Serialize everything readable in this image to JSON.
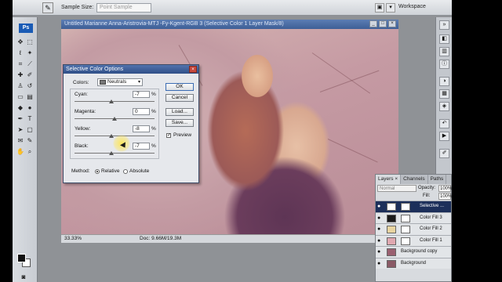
{
  "options_bar": {
    "tool_icon": "eyedropper-icon",
    "sample_size_label": "Sample Size:",
    "sample_size_value": "Point Sample",
    "workspace_label": "Workspace"
  },
  "tools_panel": {
    "logo": "Ps"
  },
  "document": {
    "title": "Untitled Marianne Anna-Aristrovia-MTJ -Fy-Kgent-RGB 3 (Selective Color 1 Layer Mask/8)",
    "zoom": "33.33%",
    "doc_info": "Doc: 9.66M/19.3M"
  },
  "dialog": {
    "title": "Selective Color Options",
    "colors_label": "Colors:",
    "colors_value": "Neutrals",
    "sliders": [
      {
        "label": "Cyan:",
        "value": "-7",
        "unit": "%",
        "level": 0.465
      },
      {
        "label": "Magenta:",
        "value": "0",
        "unit": "%",
        "level": 0.5
      },
      {
        "label": "Yellow:",
        "value": "-8",
        "unit": "%",
        "level": 0.46
      },
      {
        "label": "Black:",
        "value": "-7",
        "unit": "%",
        "level": 0.465
      }
    ],
    "method_label": "Method:",
    "relative_label": "Relative",
    "absolute_label": "Absolute",
    "method_selected": "Relative",
    "ok_label": "OK",
    "reset_label": "Cancel",
    "load_label": "Load...",
    "save_label": "Save...",
    "preview_label": "Preview",
    "preview_checked": true
  },
  "layers_panel": {
    "tabs": [
      "Layers ×",
      "Channels",
      "Paths"
    ],
    "blend_mode": "Normal",
    "opacity_label": "Opacity:",
    "opacity_value": "100%",
    "fill_label": "Fill:",
    "fill_value": "100%",
    "layers": [
      {
        "name": "Selective ...",
        "thumb_color": "#ffffff",
        "selected": true,
        "has_mask": true
      },
      {
        "name": "Color Fill 3",
        "thumb_color": "#1a1a1a",
        "selected": false,
        "has_mask": true
      },
      {
        "name": "Color Fill 2",
        "thumb_color": "#e8d4a0",
        "selected": false,
        "has_mask": true
      },
      {
        "name": "Color Fill 1",
        "thumb_color": "#e0a8b0",
        "selected": false,
        "has_mask": true
      },
      {
        "name": "Background copy",
        "thumb_color": "#9a6070",
        "selected": false,
        "has_mask": false
      },
      {
        "name": "Background",
        "thumb_color": "#8a5a66",
        "selected": false,
        "has_mask": false
      }
    ]
  },
  "colors": {
    "title_bar": "#3e5f96",
    "selected_layer": "#1c2f5a",
    "photo_tint": "#c8a3a9"
  }
}
